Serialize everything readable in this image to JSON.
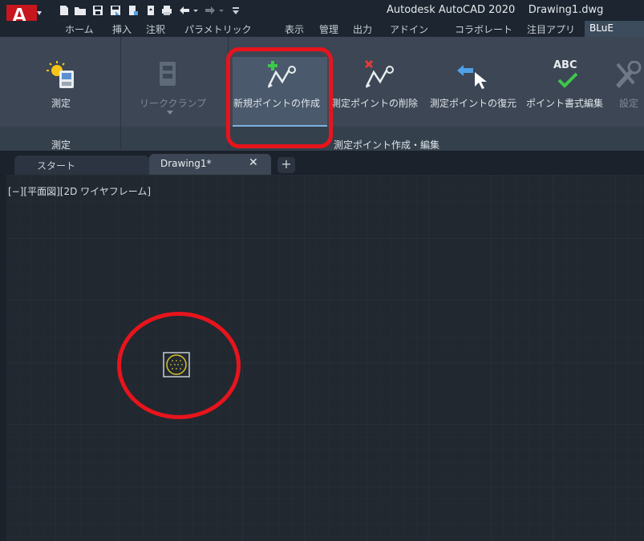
{
  "window": {
    "app_title": "Autodesk AutoCAD 2020",
    "document_title": "Drawing1.dwg",
    "logo_letter": "A"
  },
  "menu": {
    "items": [
      "ホーム",
      "挿入",
      "注釈",
      "パラメトリック",
      "表示",
      "管理",
      "出力",
      "アドイン",
      "コラボレート",
      "注目アプリ"
    ],
    "active": "BLuE"
  },
  "ribbon": {
    "buttons": {
      "measure": "測定",
      "leak_clamp": "リーククランプ",
      "new_point": "新規ポイントの作成",
      "delete_point": "測定ポイントの削除",
      "restore_point": "測定ポイントの復元",
      "point_format": "ポイント書式編集",
      "settings": "設定"
    },
    "panels": {
      "measure": "測定",
      "point_edit": "測定ポイント作成・編集"
    },
    "icons": {
      "abc_text": "ABC"
    }
  },
  "tabs": {
    "start": "スタート",
    "drawing": "Drawing1*",
    "close": "✕",
    "add": "+"
  },
  "viewport": {
    "label": "[−][平面図][2D ワイヤフレーム]"
  },
  "colors": {
    "annotation": "#e8141c",
    "accent": "#7fb2e0"
  }
}
